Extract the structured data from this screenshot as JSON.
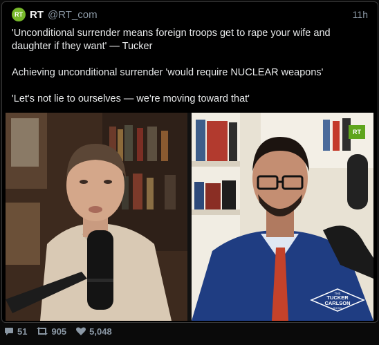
{
  "tweet": {
    "author_name": "RT",
    "avatar_text": "RT",
    "handle": "@RT_com",
    "time": "11h",
    "paragraphs": [
      "'Unconditional surrender means foreign troops get to rape your wife and daughter if they want' — Tucker",
      "Achieving unconditional surrender 'would require NUCLEAR weapons'",
      "'Let's not lie to ourselves — we're moving toward that'"
    ]
  },
  "media": {
    "rt_badge": "RT",
    "show_logo": {
      "line1": "THE",
      "line2": "TUCKER",
      "line3": "CARLSON",
      "line4": "SHOW"
    }
  },
  "stats": {
    "replies": "51",
    "retweets": "905",
    "likes": "5,048"
  },
  "colors": {
    "accent": "#77b82a",
    "muted": "#8b98a5"
  }
}
